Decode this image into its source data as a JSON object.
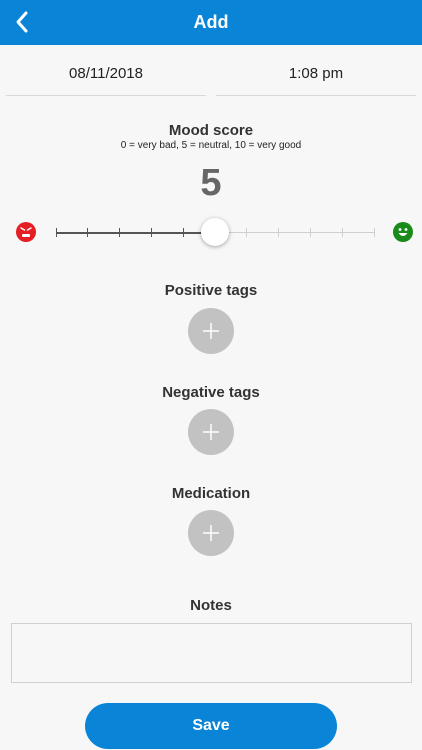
{
  "header": {
    "title": "Add"
  },
  "datetime": {
    "date": "08/11/2018",
    "time": "1:08 pm"
  },
  "mood": {
    "title": "Mood score",
    "legend": "0 = very bad, 5 = neutral, 10 = very good",
    "value": "5",
    "slider_value": 5,
    "slider_min": 0,
    "slider_max": 10
  },
  "sections": {
    "positive_tags": "Positive tags",
    "negative_tags": "Negative tags",
    "medication": "Medication",
    "notes": "Notes"
  },
  "notes": {
    "value": ""
  },
  "actions": {
    "save_label": "Save"
  },
  "colors": {
    "accent": "#0a84d6",
    "sad_face": "#e41e25",
    "happy_face": "#1a8a1a",
    "add_button": "#c2c2c2"
  },
  "icons": {
    "back": "chevron-left-icon",
    "sad": "sad-face-icon",
    "happy": "happy-face-icon",
    "add": "plus-icon"
  }
}
